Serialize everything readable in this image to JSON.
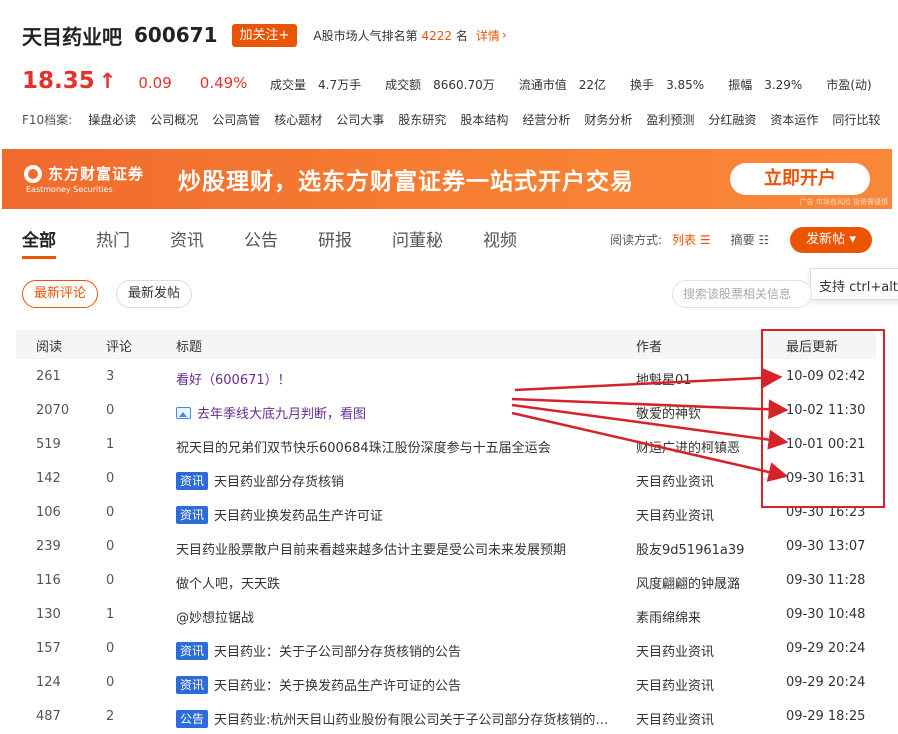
{
  "header": {
    "bar_name": "天目药业吧",
    "stock_code": "600671",
    "follow_label": "加关注+",
    "rank_prefix": "A股市场人气排名第",
    "rank_value": "4222",
    "rank_suffix": "名",
    "rank_detail": "详情"
  },
  "quote": {
    "price": "18.35",
    "arrow": "↑",
    "change": "0.09",
    "change_pct": "0.49%",
    "stats": [
      {
        "label": "成交量",
        "value": "4.7万手"
      },
      {
        "label": "成交额",
        "value": "8660.70万"
      },
      {
        "label": "流通市值",
        "value": "22亿"
      },
      {
        "label": "换手",
        "value": "3.85%"
      },
      {
        "label": "振幅",
        "value": "3.29%"
      },
      {
        "label": "市盈(动)",
        "value": ""
      }
    ]
  },
  "f10": {
    "label": "F10档案:",
    "items": [
      "操盘必读",
      "公司概况",
      "公司高管",
      "核心题材",
      "公司大事",
      "股东研究",
      "股本结构",
      "经营分析",
      "财务分析",
      "盈利预测",
      "分红融资",
      "资本运作",
      "同行比较"
    ]
  },
  "banner": {
    "logo_cn": "东方财富证券",
    "logo_en": "Eastmoney Securities",
    "slogan": "炒股理财，选东方财富证券一站式开户交易",
    "button": "立即开户",
    "ad_note": "广告 市场有风险 投资需谨慎"
  },
  "tabs": [
    "全部",
    "热门",
    "资讯",
    "公告",
    "研报",
    "问董秘",
    "视频"
  ],
  "read_mode": {
    "label": "阅读方式:",
    "list": "列表",
    "summary": "摘要"
  },
  "post_button": "发新帖",
  "tooltip": "支持 ctrl+alt+",
  "sort": {
    "latest_comment": "最新评论",
    "latest_post": "最新发帖"
  },
  "search_placeholder": "搜索该股票相关信息",
  "table": {
    "headers": {
      "read": "阅读",
      "comments": "评论",
      "title": "标题",
      "author": "作者",
      "updated": "最后更新"
    },
    "rows": [
      {
        "read": "261",
        "comments": "3",
        "tag": "",
        "title": "看好（600671）！",
        "author": "地魁星01",
        "updated": "10-09 02:42"
      },
      {
        "read": "2070",
        "comments": "0",
        "tag": "img",
        "title": "去年季线大底九月判断，看图",
        "author": "敬爱的神钦",
        "updated": "10-02 11:30"
      },
      {
        "read": "519",
        "comments": "1",
        "tag": "",
        "title": "祝天目的兄弟们双节快乐600684珠江股份深度参与十五届全运会",
        "author": "财运广进的柯镇恶",
        "updated": "10-01 00:21"
      },
      {
        "read": "142",
        "comments": "0",
        "tag": "资讯",
        "title": "天目药业部分存货核销",
        "author": "天目药业资讯",
        "updated": "09-30 16:31"
      },
      {
        "read": "106",
        "comments": "0",
        "tag": "资讯",
        "title": "天目药业换发药品生产许可证",
        "author": "天目药业资讯",
        "updated": "09-30 16:23"
      },
      {
        "read": "239",
        "comments": "0",
        "tag": "",
        "title": "天目药业股票散户目前来看越来越多估计主要是受公司未来发展预期",
        "author": "股友9d51961a39",
        "updated": "09-30 13:07"
      },
      {
        "read": "116",
        "comments": "0",
        "tag": "",
        "title": "做个人吧，天天跌",
        "author": "风度翩翩的钟晟潞",
        "updated": "09-30 11:28"
      },
      {
        "read": "130",
        "comments": "1",
        "tag": "",
        "title": "@妙想拉锯战",
        "author": "素雨绵绵来",
        "updated": "09-30 10:48"
      },
      {
        "read": "157",
        "comments": "0",
        "tag": "资讯",
        "title": "天目药业：关于子公司部分存货核销的公告",
        "author": "天目药业资讯",
        "updated": "09-29 20:24"
      },
      {
        "read": "124",
        "comments": "0",
        "tag": "资讯",
        "title": "天目药业：关于换发药品生产许可证的公告",
        "author": "天目药业资讯",
        "updated": "09-29 20:24"
      },
      {
        "read": "487",
        "comments": "2",
        "tag": "公告",
        "title": "天目药业:杭州天目山药业股份有限公司关于子公司部分存货核销的公告",
        "author": "天目药业资讯",
        "updated": "09-29 18:25"
      }
    ]
  },
  "colors": {
    "accent": "#ea5504",
    "price_up": "#e3322e",
    "annotation": "#d5222b",
    "tag_blue": "#2c6bd8",
    "visited_title": "#6a2c91"
  }
}
